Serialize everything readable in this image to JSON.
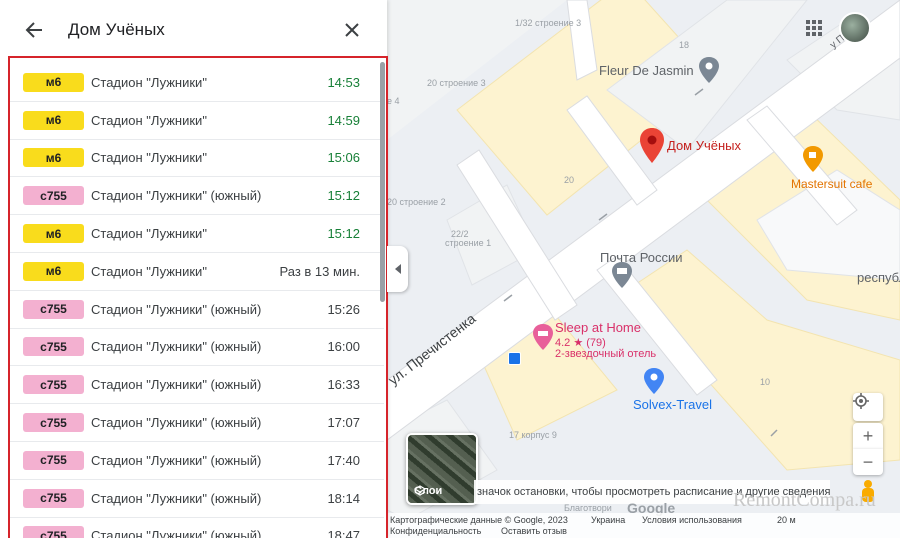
{
  "panel": {
    "title": "Дом Учёных",
    "back_icon": "arrow-back-icon",
    "close_icon": "close-icon",
    "departures": [
      {
        "route": "м6",
        "destination": "Стадион \"Лужники\"",
        "time": "14:53",
        "realtime": true,
        "badge_color": "#f9dc1c"
      },
      {
        "route": "м6",
        "destination": "Стадион \"Лужники\"",
        "time": "14:59",
        "realtime": true,
        "badge_color": "#f9dc1c"
      },
      {
        "route": "м6",
        "destination": "Стадион \"Лужники\"",
        "time": "15:06",
        "realtime": true,
        "badge_color": "#f9dc1c"
      },
      {
        "route": "с755",
        "destination": "Стадион \"Лужники\" (южный)",
        "time": "15:12",
        "realtime": true,
        "badge_color": "#f3b0d0"
      },
      {
        "route": "м6",
        "destination": "Стадион \"Лужники\"",
        "time": "15:12",
        "realtime": true,
        "badge_color": "#f9dc1c"
      },
      {
        "route": "м6",
        "destination": "Стадион \"Лужники\"",
        "time": "Раз в 13 мин.",
        "realtime": false,
        "badge_color": "#f9dc1c"
      },
      {
        "route": "с755",
        "destination": "Стадион \"Лужники\" (южный)",
        "time": "15:26",
        "realtime": false,
        "badge_color": "#f3b0d0"
      },
      {
        "route": "с755",
        "destination": "Стадион \"Лужники\" (южный)",
        "time": "16:00",
        "realtime": false,
        "badge_color": "#f3b0d0"
      },
      {
        "route": "с755",
        "destination": "Стадион \"Лужники\" (южный)",
        "time": "16:33",
        "realtime": false,
        "badge_color": "#f3b0d0"
      },
      {
        "route": "с755",
        "destination": "Стадион \"Лужники\" (южный)",
        "time": "17:07",
        "realtime": false,
        "badge_color": "#f3b0d0"
      },
      {
        "route": "с755",
        "destination": "Стадион \"Лужники\" (южный)",
        "time": "17:40",
        "realtime": false,
        "badge_color": "#f3b0d0"
      },
      {
        "route": "с755",
        "destination": "Стадион \"Лужники\" (южный)",
        "time": "18:14",
        "realtime": false,
        "badge_color": "#f3b0d0"
      },
      {
        "route": "с755",
        "destination": "Стадион \"Лужники\" (южный)",
        "time": "18:47",
        "realtime": false,
        "badge_color": "#f3b0d0"
      }
    ],
    "highlight_color": "#d6242b"
  },
  "map": {
    "labels": {
      "building_1_32": "1/32 строение 3",
      "n18": "18",
      "fleur": "Fleur De Jasmin",
      "building_20_3": "20 строение 3",
      "n4": "е 4",
      "dom_uchenykh": "Дом Учёных",
      "mastersuit": "Mastersuit cafe",
      "n20": "20",
      "building_20_2": "20 строение 2",
      "n22_2": "22/2",
      "stroenie1": "строение 1",
      "pochta": "Почта России",
      "respub": "республ",
      "street": "ул. Пречистенка",
      "sleep": "Sleep at Home",
      "rating": "4.2 ★ (79)",
      "hotel_type": "2-звездочный отель",
      "n10": "10",
      "solvex": "Solvex-Travel",
      "korpus": "17 корпус 9",
      "blagotvor": "Благотвори",
      "road_top": "у Пречи"
    },
    "layers_label": "Слои",
    "hint": "значок остановки, чтобы просмотреть расписание и другие сведения",
    "attribution": {
      "data": "Картографические данные © Google, 2023",
      "ukraine": "Украина",
      "terms": "Условия использования",
      "privacy": "Конфиденциальность",
      "feedback": "Оставить отзыв",
      "scale": "20 м"
    },
    "zoom_in": "+",
    "zoom_out": "−",
    "google_logo": "Google",
    "pin_color": "#ea4335"
  },
  "watermark": "RemontCompa.ru"
}
